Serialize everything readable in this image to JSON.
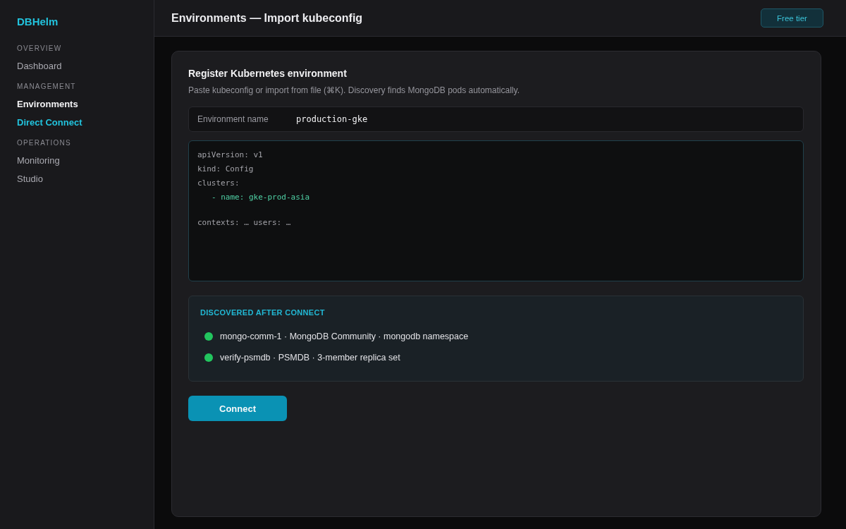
{
  "sidebar": {
    "logo": "DBHelm",
    "sections": [
      {
        "label": "OVERVIEW",
        "items": [
          {
            "label": "Dashboard",
            "selected": false,
            "accent": false
          }
        ]
      },
      {
        "label": "MANAGEMENT",
        "items": [
          {
            "label": "Environments",
            "selected": true,
            "accent": false
          },
          {
            "label": "Direct Connect",
            "selected": false,
            "accent": true
          }
        ]
      },
      {
        "label": "OPERATIONS",
        "items": [
          {
            "label": "Monitoring",
            "selected": false,
            "accent": false
          },
          {
            "label": "Studio",
            "selected": false,
            "accent": false
          }
        ]
      }
    ]
  },
  "header": {
    "title": "Environments — Import kubeconfig",
    "badge": "Free tier"
  },
  "card": {
    "title": "Register Kubernetes environment",
    "description": "Paste kubeconfig or import from file (⌘K). Discovery finds MongoDB pods automatically.",
    "name_field": {
      "label": "Environment name",
      "value": "production-gke"
    },
    "kubeconfig": {
      "blocks": [
        {
          "lines": [
            {
              "text": "apiVersion: v1",
              "kind": "key"
            },
            {
              "text": "kind: Config",
              "kind": "key"
            },
            {
              "text": "clusters:",
              "kind": "key"
            },
            {
              "text": "- name: gke-prod-asia",
              "kind": "item"
            }
          ]
        },
        {
          "lines": [
            {
              "text": "contexts: … users: …",
              "kind": "key"
            }
          ]
        }
      ]
    },
    "discovered": {
      "title": "DISCOVERED AFTER CONNECT",
      "items": [
        {
          "text": "mongo-comm-1 · MongoDB Community · mongodb namespace",
          "color": "#22c55e"
        },
        {
          "text": "verify-psmdb · PSMDB · 3-member replica set",
          "color": "#22c55e"
        }
      ]
    },
    "button": "Connect"
  }
}
